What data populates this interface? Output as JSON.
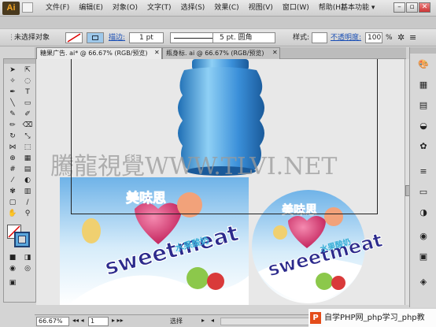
{
  "app": {
    "logo": "Ai",
    "workspace": "基本功能"
  },
  "menu": [
    "文件(F)",
    "编辑(E)",
    "对象(O)",
    "文字(T)",
    "选择(S)",
    "效果(C)",
    "视图(V)",
    "窗口(W)",
    "帮助(H)"
  ],
  "control": {
    "selection": "未选择对象",
    "stroke_label": "描边:",
    "stroke_weight": "1 pt",
    "stroke_profile": "等比",
    "brush": "5 pt. 圆角",
    "style_label": "样式:",
    "opacity_label": "不透明度:",
    "opacity_value": "100",
    "opacity_unit": "%"
  },
  "tabs": [
    {
      "label": "糖果广告. ai* @ 66.67% (RGB/预览)",
      "active": true
    },
    {
      "label": "瓶身标. ai @ 66.67% (RGB/预览)",
      "active": false
    }
  ],
  "canvas": {
    "watermark": "騰龍視覺WWW.TLVI.NET",
    "brand_cn": "美味思",
    "brand_en": "sweetmeat",
    "slogan": "水果酸奶"
  },
  "status": {
    "zoom": "66.67%",
    "page": "1",
    "mode": "选择"
  },
  "overlay": {
    "text": "自学PHP网_php学习_php教",
    "logo": "P"
  },
  "colors": {
    "bottle": "#3a8fd9",
    "brand_text": "#2c2a8c",
    "slogan": "#3ab0d8",
    "heart": "#d9326a"
  }
}
